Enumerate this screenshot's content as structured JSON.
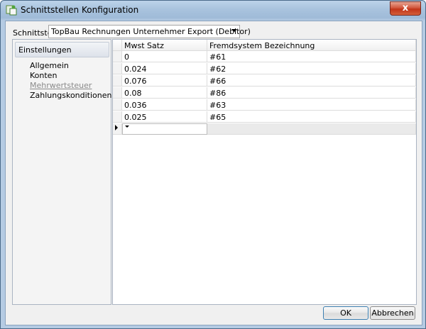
{
  "window": {
    "title": "Schnittstellen Konfiguration",
    "close_glyph": "x",
    "icon": "app-icon"
  },
  "interface": {
    "label": "Schnittstelle",
    "selected": "TopBau Rechnungen Unternehmer Export (Debitor)"
  },
  "nav": {
    "header": "Einstellungen",
    "items": [
      {
        "label": "Allgemein",
        "selected": false
      },
      {
        "label": "Konten",
        "selected": false
      },
      {
        "label": "Mehrwertsteuer",
        "selected": true
      },
      {
        "label": "Zahlungskonditionen",
        "selected": false
      }
    ]
  },
  "grid": {
    "columns": [
      "Mwst Satz",
      "Fremdsystem Bezeichnung"
    ],
    "rows": [
      [
        "0",
        "#61"
      ],
      [
        "0.024",
        "#62"
      ],
      [
        "0.076",
        "#66"
      ],
      [
        "0.08",
        "#86"
      ],
      [
        "0.036",
        "#63"
      ],
      [
        "0.025",
        "#65"
      ]
    ]
  },
  "buttons": {
    "ok": "OK",
    "cancel": "Abbrechen"
  }
}
